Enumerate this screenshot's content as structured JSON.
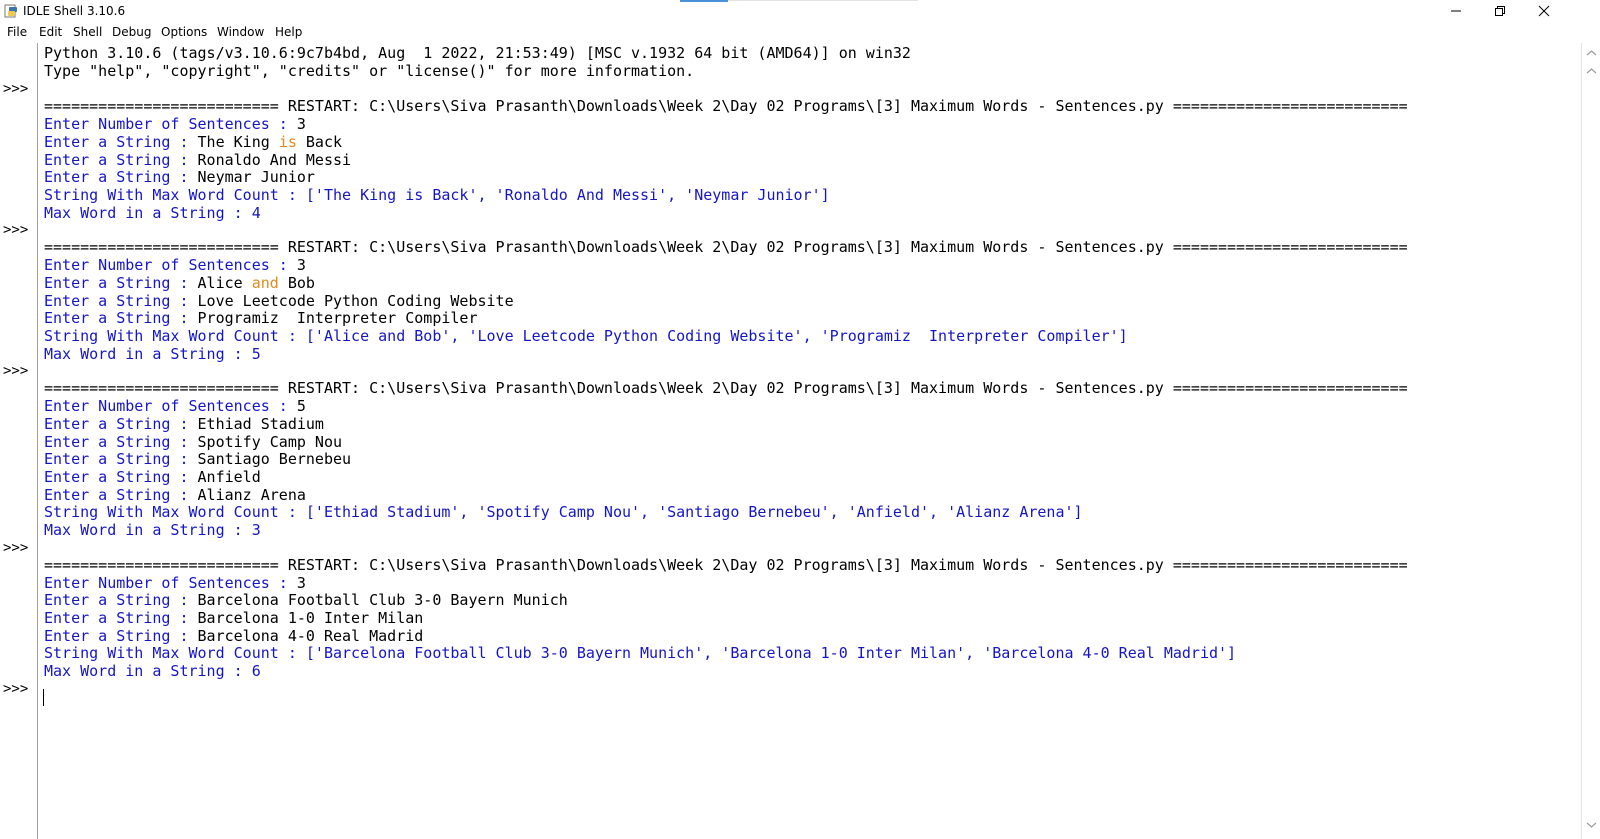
{
  "window": {
    "title": "IDLE Shell 3.10.6",
    "icon": "python-idle-icon",
    "controls": [
      "minimize-icon",
      "restore-icon",
      "close-icon"
    ]
  },
  "menubar": {
    "items": [
      "File",
      "Edit",
      "Shell",
      "Debug",
      "Options",
      "Window",
      "Help"
    ]
  },
  "gutter": {
    "prompt": ">>>"
  },
  "shell": {
    "banner": [
      "Python 3.10.6 (tags/v3.10.6:9c7b4bd, Aug  1 2022, 21:53:49) [MSC v.1932 64 bit (AMD64)] on win32",
      "Type \"help\", \"copyright\", \"credits\" or \"license()\" for more information."
    ],
    "restart_line": "========================== RESTART: C:\\Users\\Siva Prasanth\\Downloads\\Week 2\\Day 02 Programs\\[3] Maximum Words - Sentences.py ==========================",
    "runs": [
      {
        "count_prompt": "Enter Number of Sentences : ",
        "count": "3",
        "inputs": [
          {
            "prompt": "Enter a String : ",
            "pre": "The King ",
            "kw": "is",
            "post": " Back"
          },
          {
            "prompt": "Enter a String : ",
            "pre": "Ronaldo And Messi",
            "kw": "",
            "post": ""
          },
          {
            "prompt": "Enter a String : ",
            "pre": "Neymar Junior",
            "kw": "",
            "post": ""
          }
        ],
        "result": "String With Max Word Count : ['The King is Back', 'Ronaldo And Messi', 'Neymar Junior']",
        "max": "Max Word in a String : 4"
      },
      {
        "count_prompt": "Enter Number of Sentences : ",
        "count": "3",
        "inputs": [
          {
            "prompt": "Enter a String : ",
            "pre": "Alice ",
            "kw": "and",
            "post": " Bob"
          },
          {
            "prompt": "Enter a String : ",
            "pre": "Love Leetcode Python Coding Website",
            "kw": "",
            "post": ""
          },
          {
            "prompt": "Enter a String : ",
            "pre": "Programiz  Interpreter Compiler",
            "kw": "",
            "post": ""
          }
        ],
        "result": "String With Max Word Count : ['Alice and Bob', 'Love Leetcode Python Coding Website', 'Programiz  Interpreter Compiler']",
        "max": "Max Word in a String : 5"
      },
      {
        "count_prompt": "Enter Number of Sentences : ",
        "count": "5",
        "inputs": [
          {
            "prompt": "Enter a String : ",
            "pre": "Ethiad Stadium",
            "kw": "",
            "post": ""
          },
          {
            "prompt": "Enter a String : ",
            "pre": "Spotify Camp Nou",
            "kw": "",
            "post": ""
          },
          {
            "prompt": "Enter a String : ",
            "pre": "Santiago Bernebeu",
            "kw": "",
            "post": ""
          },
          {
            "prompt": "Enter a String : ",
            "pre": "Anfield",
            "kw": "",
            "post": ""
          },
          {
            "prompt": "Enter a String : ",
            "pre": "Alianz Arena",
            "kw": "",
            "post": ""
          }
        ],
        "result": "String With Max Word Count : ['Ethiad Stadium', 'Spotify Camp Nou', 'Santiago Bernebeu', 'Anfield', 'Alianz Arena']",
        "max": "Max Word in a String : 3"
      },
      {
        "count_prompt": "Enter Number of Sentences : ",
        "count": "3",
        "inputs": [
          {
            "prompt": "Enter a String : ",
            "pre": "Barcelona Football Club 3-0 Bayern Munich",
            "kw": "",
            "post": ""
          },
          {
            "prompt": "Enter a String : ",
            "pre": "Barcelona 1-0 Inter Milan",
            "kw": "",
            "post": ""
          },
          {
            "prompt": "Enter a String : ",
            "pre": "Barcelona 4-0 Real Madrid",
            "kw": "",
            "post": ""
          }
        ],
        "result": "String With Max Word Count : ['Barcelona Football Club 3-0 Bayern Munich', 'Barcelona 1-0 Inter Milan', 'Barcelona 4-0 Real Madrid']",
        "max": "Max Word in a String : 6"
      }
    ]
  },
  "colors": {
    "output": "#1515c8",
    "input": "#000000",
    "keyword": "#e08a1e"
  }
}
